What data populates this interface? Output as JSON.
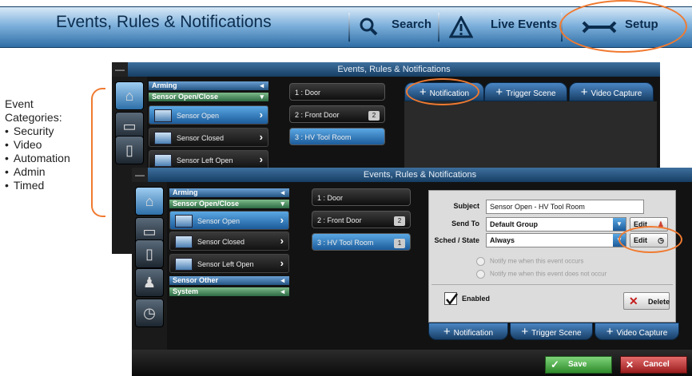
{
  "banner": {
    "title": "Events, Rules & Notifications",
    "search_label": "Search",
    "live_events_label": "Live Events",
    "setup_label": "Setup"
  },
  "note": {
    "heading_line1": "Event",
    "heading_line2": "Categories:",
    "categories": [
      "Security",
      "Video",
      "Automation",
      "Admin",
      "Timed"
    ]
  },
  "back_window": {
    "title": "Events, Rules & Notifications",
    "min_label": "—",
    "category_headers": [
      "Arming",
      "Sensor Open/Close"
    ],
    "category_items": [
      "Sensor Open",
      "Sensor Closed",
      "Sensor Left Open"
    ],
    "devices": [
      "1 : Door",
      "2 : Front Door",
      "3 : HV Tool Room"
    ],
    "device_badges": [
      "",
      "2",
      ""
    ],
    "tabs": [
      "Notification",
      "Trigger Scene",
      "Video Capture"
    ]
  },
  "front_window": {
    "title": "Events, Rules & Notifications",
    "min_label": "—",
    "category_headers": [
      "Arming",
      "Sensor Open/Close"
    ],
    "category_items": [
      "Sensor Open",
      "Sensor Closed",
      "Sensor Left Open"
    ],
    "category_footers": [
      "Sensor Other",
      "System"
    ],
    "devices": [
      "1 : Door",
      "2 : Front Door",
      "3 : HV Tool Room"
    ],
    "device_badges": [
      "",
      "2",
      "1"
    ],
    "form": {
      "subject_label": "Subject",
      "subject_value": "Sensor Open - HV Tool Room",
      "send_to_label": "Send To",
      "send_to_value": "Default Group",
      "sched_label": "Sched / State",
      "sched_value": "Always",
      "edit_label": "Edit",
      "radio_1": "Notify me when this event occurs",
      "radio_2": "Notify me when this event does not occur",
      "enabled_label": "Enabled",
      "delete_label": "Delete"
    },
    "tabs": [
      "Notification",
      "Trigger Scene",
      "Video Capture"
    ],
    "save_label": "Save",
    "cancel_label": "Cancel"
  }
}
